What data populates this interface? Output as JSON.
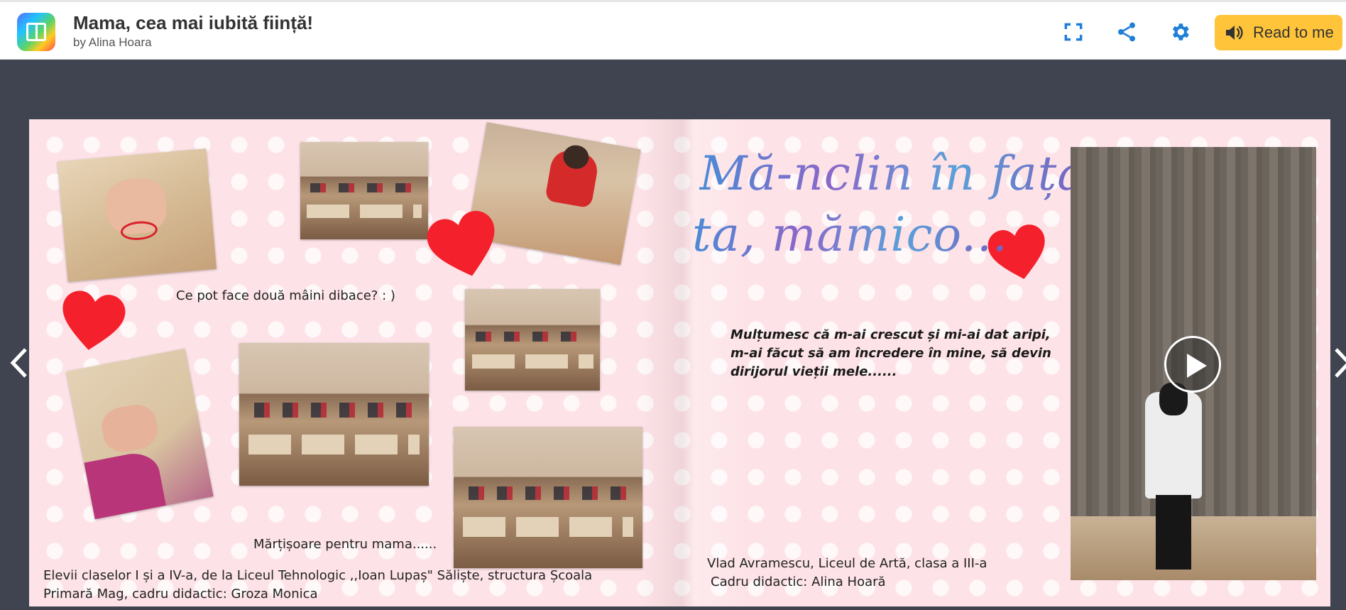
{
  "header": {
    "title": "Mama, cea mai iubită ființă!",
    "author": "by Alina Hoara",
    "read_label": "Read to me",
    "icons": [
      "fullscreen-icon",
      "share-icon",
      "settings-gear-icon",
      "speaker-icon"
    ],
    "accent_color": "#1f7ed8",
    "read_button_color": "#ffc43a"
  },
  "left_page": {
    "caption_hands": "Ce pot face două mâini dibace? : )",
    "caption_martisoare": "Mărțișoare pentru mama......",
    "credits_line1": "Elevii claselor I și a IV-a, de la Liceul Tehnologic ,,Ioan Lupaș\" Săliște, structura Școala",
    "credits_line2": "Primară Mag, cadru didactic: Groza Monica"
  },
  "right_page": {
    "handwritten_line1": "Mă-nclin în fața",
    "handwritten_line2": "ta, mămico...",
    "quote_line1": "Mulțumesc că m-ai crescut și mi-ai dat aripi,",
    "quote_line2": "m-ai făcut să am încredere în mine, să devin",
    "quote_line3": "dirijorul vieții mele......",
    "credits_line1": "Vlad Avramescu, Liceul de Artă, clasa a III-a",
    "credits_line2": "Cadru didactic: Alina Hoară"
  },
  "colors": {
    "page_background": "#fde3e7",
    "heart": "#f4202b",
    "viewer_background": "#3f4450"
  }
}
